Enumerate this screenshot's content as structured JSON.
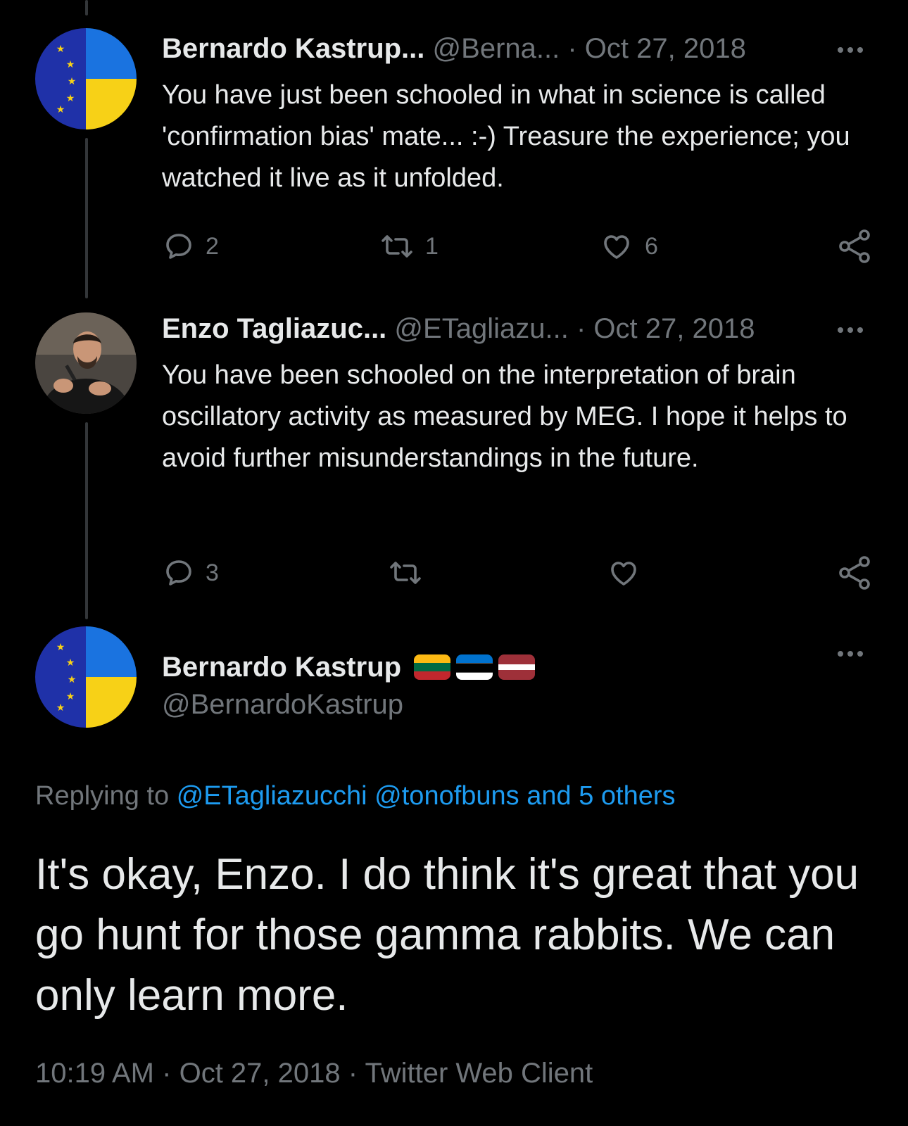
{
  "tweets": [
    {
      "name": "Bernardo Kastrup...",
      "handle": "@Berna...",
      "separator": "·",
      "date": "Oct 27, 2018",
      "text": "You have just been schooled in what in science is called 'confirmation bias' mate... :-) Treasure the experience; you watched it live as it unfolded.",
      "avatar": "eu-ukraine-flag-avatar",
      "replies": "2",
      "retweets": "1",
      "likes": "6"
    },
    {
      "name": "Enzo Tagliazuc...",
      "handle": "@ETagliazu...",
      "separator": "·",
      "date": "Oct 27, 2018",
      "text": "You have been schooled on the interpretation of brain oscillatory activity as measured by MEG. I hope it helps to avoid further misunderstandings in the future.",
      "avatar": "speaker-photo-avatar",
      "replies": "3",
      "retweets": "",
      "likes": ""
    }
  ],
  "main_tweet": {
    "name": "Bernardo Kastrup",
    "flags": [
      "lithuania-flag",
      "estonia-flag",
      "latvia-flag"
    ],
    "handle": "@BernardoKastrup",
    "replying_prefix": "Replying to",
    "replying_to_1": "@ETagliazucchi",
    "replying_to_2": "@tonofbuns",
    "replying_others": "and 5 others",
    "text": "It's okay, Enzo. I do think it's great that you go hunt for those gamma rabbits. We can only learn more.",
    "time": "10:19 AM",
    "separator": "·",
    "date": "Oct 27, 2018",
    "client": "Twitter Web Client"
  },
  "colors": {
    "background": "#000000",
    "text": "#e7e9ea",
    "muted": "#71767b",
    "link": "#1d9bf0",
    "thread_line": "#333639",
    "eu_blue": "#1f31a8",
    "ua_blue": "#1a73e0",
    "ua_yellow": "#f7d117"
  }
}
